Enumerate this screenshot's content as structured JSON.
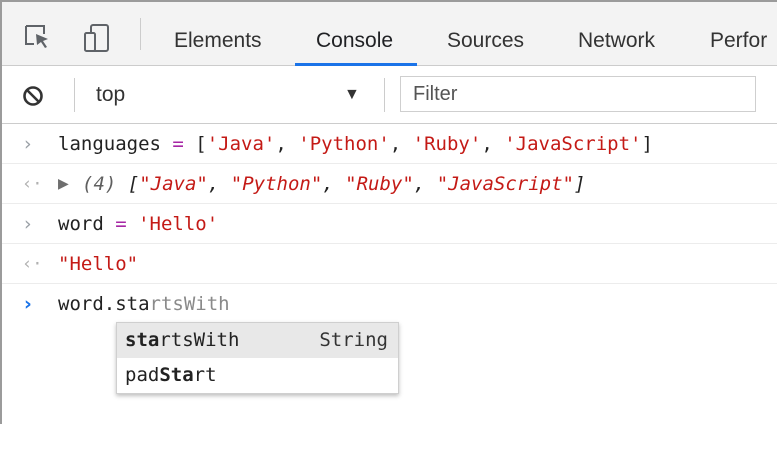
{
  "tabs": [
    {
      "label": "Elements"
    },
    {
      "label": "Console"
    },
    {
      "label": "Sources"
    },
    {
      "label": "Network"
    },
    {
      "label": "Perfor"
    }
  ],
  "active_tab": "Console",
  "toolbar": {
    "context": "top",
    "filter_placeholder": "Filter"
  },
  "console": {
    "input1": {
      "var": "languages",
      "op": " = ",
      "items": [
        "'Java'",
        "'Python'",
        "'Ruby'",
        "'JavaScript'"
      ]
    },
    "result1": {
      "count": "(4)",
      "items": [
        "\"Java\"",
        "\"Python\"",
        "\"Ruby\"",
        "\"JavaScript\""
      ]
    },
    "input2": {
      "var": "word",
      "op": " = ",
      "value": "'Hello'"
    },
    "result2": {
      "value": "\"Hello\""
    },
    "current": {
      "typed": "word.sta",
      "ghost": "rtsWith"
    }
  },
  "autocomplete": [
    {
      "match": "sta",
      "rest": "rtsWith",
      "type": "String",
      "selected": true
    },
    {
      "prefix": "pad",
      "match": "Sta",
      "rest": "rt",
      "type": "",
      "selected": false
    }
  ],
  "colors": {
    "accent": "#1a73e8",
    "string": "#c41a16",
    "operator": "#a626a4"
  },
  "icons": [
    "inspect-element-icon",
    "device-toolbar-icon",
    "clear-console-icon",
    "dropdown-arrow-icon",
    "expand-triangle-icon",
    "prompt-chevron-icon",
    "result-arrow-icon"
  ]
}
